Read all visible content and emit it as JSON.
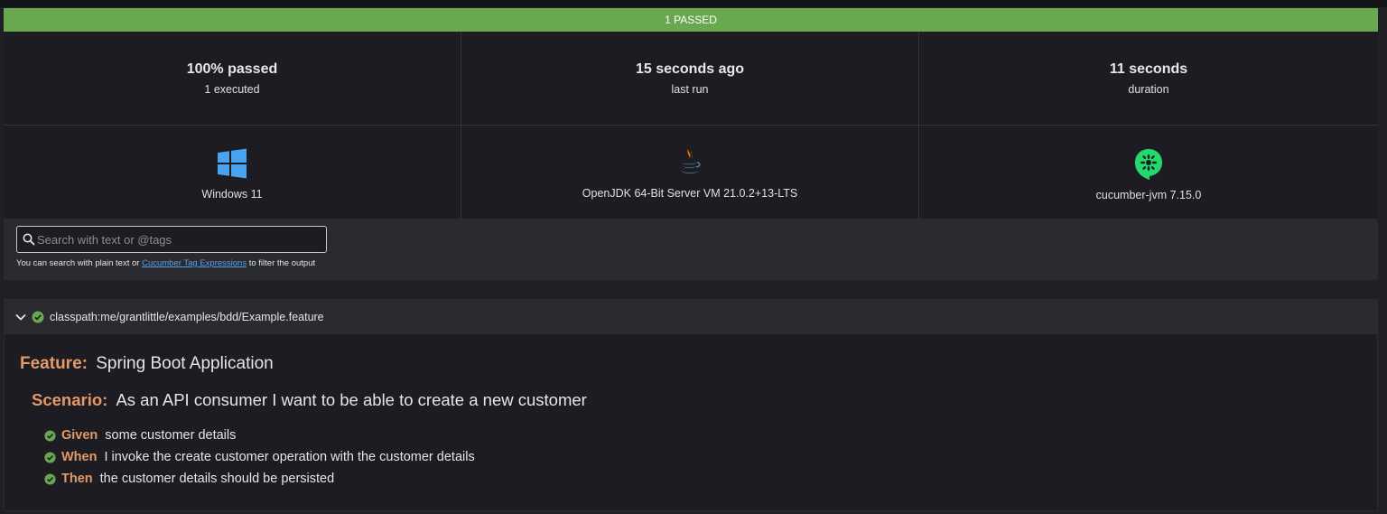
{
  "status_bar": {
    "label": "1 PASSED",
    "color": "#6aa84f"
  },
  "stats": [
    {
      "value": "100% passed",
      "label": "1 executed"
    },
    {
      "value": "15 seconds ago",
      "label": "last run"
    },
    {
      "value": "11 seconds",
      "label": "duration"
    }
  ],
  "environment": [
    {
      "icon": "windows-icon",
      "label": "Windows 11"
    },
    {
      "icon": "java-icon",
      "label": "OpenJDK 64-Bit Server VM 21.0.2+13-LTS"
    },
    {
      "icon": "cucumber-icon",
      "label": "cucumber-jvm 7.15.0"
    }
  ],
  "search": {
    "placeholder": "Search with text or @tags",
    "value": "",
    "hint_prefix": "You can search with plain text or ",
    "hint_link": "Cucumber Tag Expressions",
    "hint_suffix": " to filter the output"
  },
  "feature": {
    "path": "classpath:me/grantlittle/examples/bdd/Example.feature",
    "keyword": "Feature:",
    "name": "Spring Boot Application",
    "scenario": {
      "keyword": "Scenario:",
      "name": "As an API consumer I want to be able to create a new customer",
      "steps": [
        {
          "keyword": "Given",
          "text": "some customer details"
        },
        {
          "keyword": "When",
          "text": "I invoke the create customer operation with the customer details"
        },
        {
          "keyword": "Then",
          "text": "the customer details should be persisted"
        }
      ]
    }
  },
  "colors": {
    "passed": "#6aa84f",
    "keyword": "#e39a68",
    "link": "#5aa0e6"
  }
}
